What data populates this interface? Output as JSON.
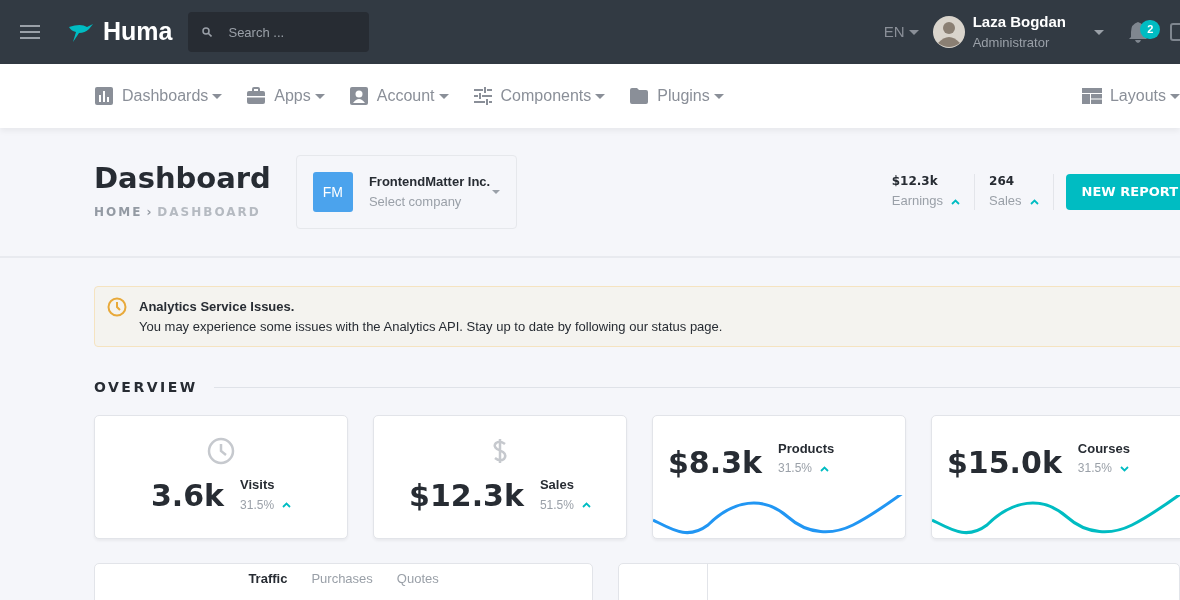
{
  "topbar": {
    "brand": "Huma",
    "search": {
      "placeholder": "Search ..."
    },
    "language": "EN",
    "user": {
      "name": "Laza Bogdan",
      "role": "Administrator"
    },
    "notifications": "2"
  },
  "nav": {
    "items": [
      {
        "label": "Dashboards"
      },
      {
        "label": "Apps"
      },
      {
        "label": "Account"
      },
      {
        "label": "Components"
      },
      {
        "label": "Plugins"
      }
    ],
    "layouts": "Layouts"
  },
  "header": {
    "title": "Dashboard",
    "breadcrumb": [
      {
        "label": "HOME",
        "selected": false
      },
      {
        "label": "DASHBOARD",
        "selected": true
      }
    ],
    "breadcrumb_separator": "›",
    "company": {
      "initials": "FM",
      "name": "FrontendMatter Inc.",
      "hint": "Select company"
    },
    "stats": [
      {
        "value": "$12.3k",
        "label": "Earnings",
        "up": true
      },
      {
        "value": "264",
        "label": "Sales",
        "up": true
      }
    ],
    "button": "NEW REPORT"
  },
  "alert": {
    "title": "Analytics Service Issues.",
    "message": "You may experience some issues with the Analytics API. Stay up to date by following our status page."
  },
  "overview": {
    "title": "OVERVIEW",
    "cards": [
      {
        "kind": "icon",
        "value": "3.6k",
        "label": "Visits",
        "percent": "31.5%",
        "up": true
      },
      {
        "kind": "icon",
        "value": "$12.3k",
        "label": "Sales",
        "percent": "51.5%",
        "up": true
      },
      {
        "kind": "sparkline",
        "value": "$8.3k",
        "label": "Products",
        "percent": "31.5%",
        "up": true,
        "color": "#2196f3"
      },
      {
        "kind": "sparkline",
        "value": "$15.0k",
        "label": "Courses",
        "percent": "31.5%",
        "up": false,
        "color": "#00bcc2"
      }
    ]
  },
  "tabs": [
    {
      "label": "Traffic",
      "selected": true
    },
    {
      "label": "Purchases",
      "selected": false
    },
    {
      "label": "Quotes",
      "selected": false
    }
  ]
}
